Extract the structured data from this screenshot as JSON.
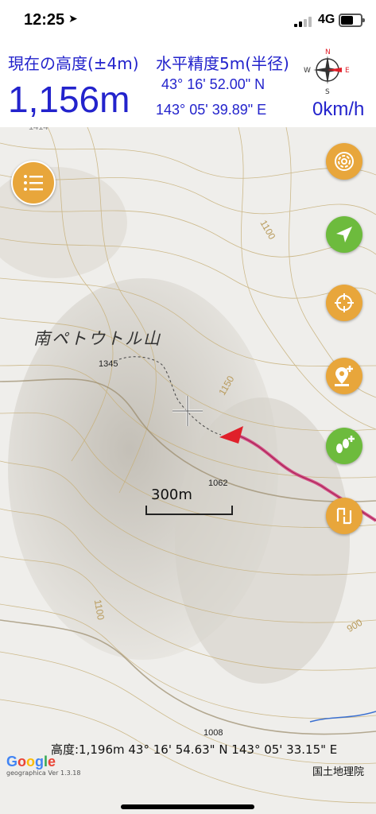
{
  "status": {
    "time": "12:25",
    "network": "4G"
  },
  "header": {
    "altitude_label": "現在の高度(±4m)",
    "altitude_value": "1,156m",
    "accuracy_label": "水平精度5m(半径)",
    "latitude": "43° 16' 52.00\" N",
    "longitude": "143° 05' 39.89\" E",
    "speed": "0km/h",
    "compass_letters": {
      "n": "N",
      "e": "E",
      "s": "S",
      "w": "W"
    }
  },
  "map": {
    "peak_name": "南ペトウトル山",
    "top_label": "1414",
    "elevations": [
      "1345",
      "1062",
      "1008"
    ],
    "contour_labels": [
      "1100",
      "1150",
      "1100",
      "900"
    ],
    "scale_label": "300m",
    "bottom_coords": "高度:1,196m  43° 16' 54.63\" N 143° 05' 33.15\" E",
    "google_logo": "Google",
    "geographica_version": "geographica Ver 1.3.18",
    "gsi_credit": "国土地理院"
  },
  "buttons": {
    "menu": "list-icon",
    "right": [
      "spiral-icon",
      "navigation-arrow-icon",
      "crosshair-icon",
      "add-pin-icon",
      "add-footprints-icon",
      "swap-route-icon"
    ]
  },
  "colors": {
    "accent_blue": "#2323cc",
    "orange": "#e8a63b",
    "green": "#6dbb3d",
    "track": "#d23a7a",
    "marker": "#e0202a"
  }
}
